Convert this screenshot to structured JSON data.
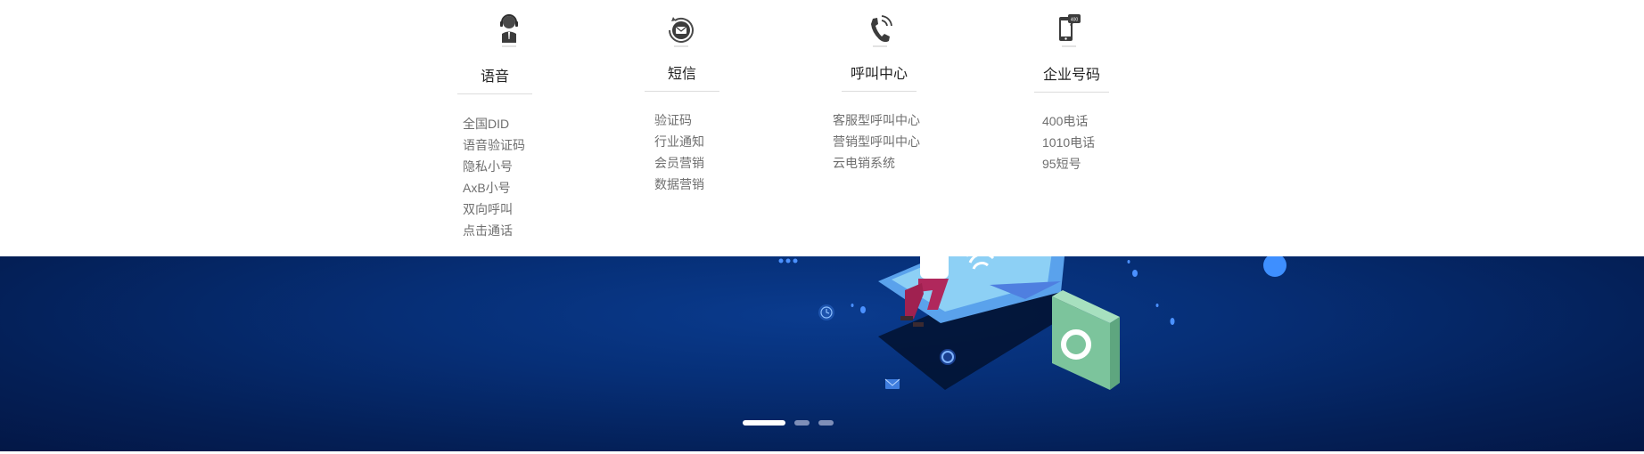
{
  "menu": {
    "columns": [
      {
        "title": "语音",
        "icon": "customer-service-icon",
        "items": [
          "全国DID",
          "语音验证码",
          "隐私小号",
          "AxB小号",
          "双向呼叫",
          "点击通话"
        ]
      },
      {
        "title": "短信",
        "icon": "sms-envelope-icon",
        "items": [
          "验证码",
          "行业通知",
          "会员营销",
          "数据营销"
        ]
      },
      {
        "title": "呼叫中心",
        "icon": "phone-call-icon",
        "items": [
          "客服型呼叫中心",
          "营销型呼叫中心",
          "云电销系统"
        ]
      },
      {
        "title": "企业号码",
        "icon": "mobile-number-icon",
        "items": [
          "400电话",
          "1010电话",
          "95短号"
        ]
      }
    ]
  },
  "banner": {
    "background_color": "#062f77",
    "carousel": {
      "slide_count": 3,
      "active_index": 0
    }
  }
}
